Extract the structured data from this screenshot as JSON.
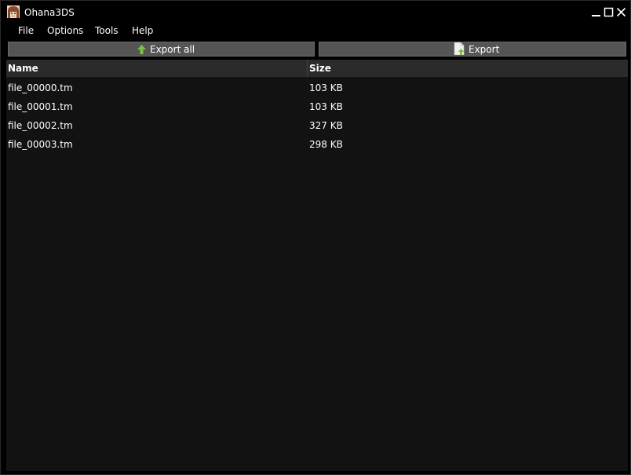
{
  "window": {
    "title": "Ohana3DS"
  },
  "menu": [
    "File",
    "Options",
    "Tools",
    "Help"
  ],
  "toolbar": {
    "export_all_label": "Export all",
    "export_label": "Export"
  },
  "list": {
    "columns": [
      "Name",
      "Size"
    ],
    "rows": [
      {
        "name": "file_00000.tm",
        "size": "103 KB"
      },
      {
        "name": "file_00001.tm",
        "size": "103 KB"
      },
      {
        "name": "file_00002.tm",
        "size": "327 KB"
      },
      {
        "name": "file_00003.tm",
        "size": "298 KB"
      }
    ]
  },
  "colors": {
    "window_bg": "#000000",
    "list_bg": "#121212",
    "header_bg": "#2b2b2b",
    "button_bg": "#555555",
    "accent_green": "#7cc242"
  },
  "icons": {
    "app": "app-character-icon",
    "export_all": "green-up-arrow-icon",
    "export": "document-export-icon"
  }
}
